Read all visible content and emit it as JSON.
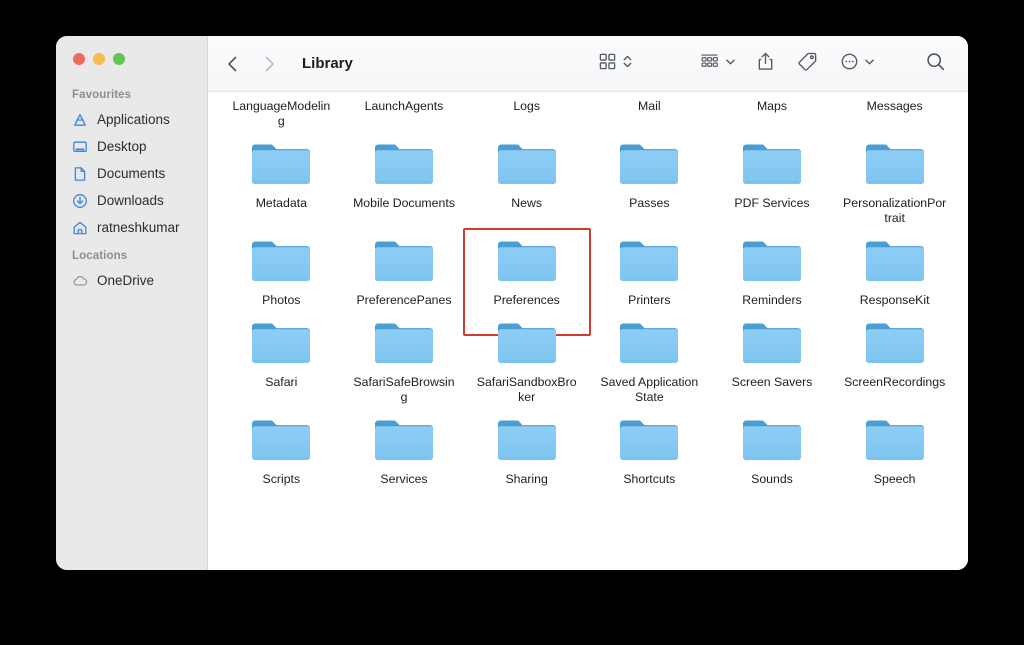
{
  "window": {
    "title": "Library",
    "traffic_lights": [
      {
        "name": "close",
        "color": "#ec6a5e"
      },
      {
        "name": "minimize",
        "color": "#f3bd4e"
      },
      {
        "name": "maximize",
        "color": "#61c454"
      }
    ]
  },
  "toolbar": {
    "back_icon": "chevron-left-icon",
    "forward_icon": "chevron-right-icon",
    "items": [
      {
        "icon": "grid-view-icon",
        "has_chevron": true,
        "chevron": "up-down-chevron-icon"
      },
      {
        "icon": "group-by-icon",
        "has_chevron": true,
        "chevron": "chevron-down-icon"
      },
      {
        "icon": "share-icon",
        "has_chevron": false
      },
      {
        "icon": "tag-icon",
        "has_chevron": false
      },
      {
        "icon": "more-options-icon",
        "has_chevron": true,
        "chevron": "chevron-down-icon"
      },
      {
        "icon": "search-icon",
        "has_chevron": false
      }
    ]
  },
  "sidebar": {
    "groups": [
      {
        "title": "Favourites",
        "items": [
          {
            "label": "Applications",
            "icon": "applications-icon"
          },
          {
            "label": "Desktop",
            "icon": "desktop-icon"
          },
          {
            "label": "Documents",
            "icon": "documents-icon"
          },
          {
            "label": "Downloads",
            "icon": "downloads-icon"
          },
          {
            "label": "ratneshkumar",
            "icon": "home-icon"
          }
        ]
      },
      {
        "title": "Locations",
        "items": [
          {
            "label": "OneDrive",
            "icon": "cloud-icon"
          }
        ]
      }
    ]
  },
  "content": {
    "selection_color": "#cd3f2c",
    "folder_colors": {
      "back": "#4a9fd4",
      "front": "#7dc5f0"
    },
    "rows": [
      {
        "label_only": true,
        "items": [
          {
            "name": "LanguageModeling",
            "selected": false
          },
          {
            "name": "LaunchAgents",
            "selected": false
          },
          {
            "name": "Logs",
            "selected": false
          },
          {
            "name": "Mail",
            "selected": false
          },
          {
            "name": "Maps",
            "selected": false
          },
          {
            "name": "Messages",
            "selected": false
          }
        ]
      },
      {
        "label_only": false,
        "items": [
          {
            "name": "Metadata",
            "selected": false
          },
          {
            "name": "Mobile Documents",
            "selected": false
          },
          {
            "name": "News",
            "selected": false
          },
          {
            "name": "Passes",
            "selected": false
          },
          {
            "name": "PDF Services",
            "selected": false
          },
          {
            "name": "PersonalizationPortrait",
            "selected": false
          }
        ]
      },
      {
        "label_only": false,
        "items": [
          {
            "name": "Photos",
            "selected": false
          },
          {
            "name": "PreferencePanes",
            "selected": false
          },
          {
            "name": "Preferences",
            "selected": true
          },
          {
            "name": "Printers",
            "selected": false
          },
          {
            "name": "Reminders",
            "selected": false
          },
          {
            "name": "ResponseKit",
            "selected": false
          }
        ]
      },
      {
        "label_only": false,
        "items": [
          {
            "name": "Safari",
            "selected": false
          },
          {
            "name": "SafariSafeBrowsing",
            "selected": false
          },
          {
            "name": "SafariSandboxBroker",
            "selected": false
          },
          {
            "name": "Saved Application State",
            "selected": false
          },
          {
            "name": "Screen Savers",
            "selected": false
          },
          {
            "name": "ScreenRecordings",
            "selected": false
          }
        ]
      },
      {
        "label_only": false,
        "items": [
          {
            "name": "Scripts",
            "selected": false
          },
          {
            "name": "Services",
            "selected": false
          },
          {
            "name": "Sharing",
            "selected": false
          },
          {
            "name": "Shortcuts",
            "selected": false
          },
          {
            "name": "Sounds",
            "selected": false
          },
          {
            "name": "Speech",
            "selected": false
          }
        ]
      }
    ]
  }
}
